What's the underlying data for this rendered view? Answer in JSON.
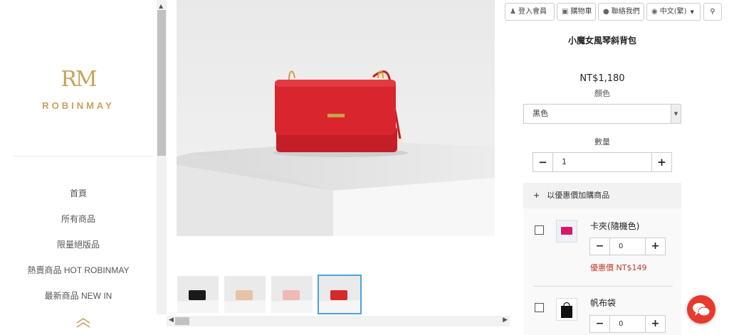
{
  "sidebar": {
    "logo_mark": "RM",
    "brand": "ROBINMAY",
    "nav": [
      "首頁",
      "所有商品",
      "限量絕版品",
      "熱賣商品 HOT ROBINMAY",
      "最新商品 NEW IN"
    ],
    "collapse_icon": "double-chevron-up-icon"
  },
  "topbar": {
    "login": "登入會員",
    "cart": "購物車",
    "contact": "聯絡我們",
    "language": "中文(繁)",
    "icons": {
      "login": "user-icon",
      "cart": "cart-icon",
      "contact": "chat-bubble-icon",
      "language": "globe-icon",
      "search": "search-icon"
    }
  },
  "product": {
    "name": "小魔女風琴斜背包",
    "price": "NT$1,180",
    "color_label": "顏色",
    "color_value": "黑色",
    "qty_label": "數量",
    "qty_value": "1"
  },
  "addon": {
    "header": "以優惠價加購商品",
    "items": [
      {
        "name": "卡夾(隨機色)",
        "qty": "0",
        "promo": "優惠價 NT$149",
        "thumb_color": "#d6186a"
      },
      {
        "name": "帆布袋",
        "qty": "0",
        "promo": "",
        "thumb_color": "#111111"
      }
    ]
  },
  "gallery": {
    "thumb_colors": [
      "#1a1a1a",
      "#e8c2a4",
      "#f0b8b8",
      "#d42a2a"
    ],
    "active_thumb": 3
  },
  "colors": {
    "brand_gold": "#c7a258",
    "promo_red": "#c0392b",
    "chat_red": "#e8392d",
    "thumb_active": "#4aa3df"
  }
}
